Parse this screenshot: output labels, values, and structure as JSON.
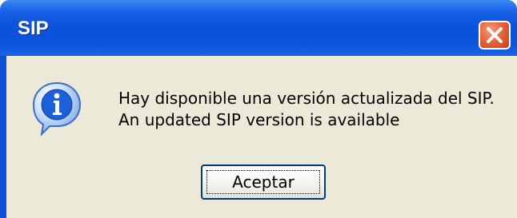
{
  "window": {
    "title": "SIP",
    "close_icon": "close-icon"
  },
  "dialog": {
    "icon": "info-icon",
    "message_line1": "Hay disponible una versión actualizada del SIP.",
    "message_line2": "An updated SIP version is available",
    "ok_label": "Aceptar"
  },
  "colors": {
    "titlebar": "#0b51db",
    "client_bg": "#ece9d8",
    "close_button": "#e5653f",
    "button_border": "#003c74"
  }
}
